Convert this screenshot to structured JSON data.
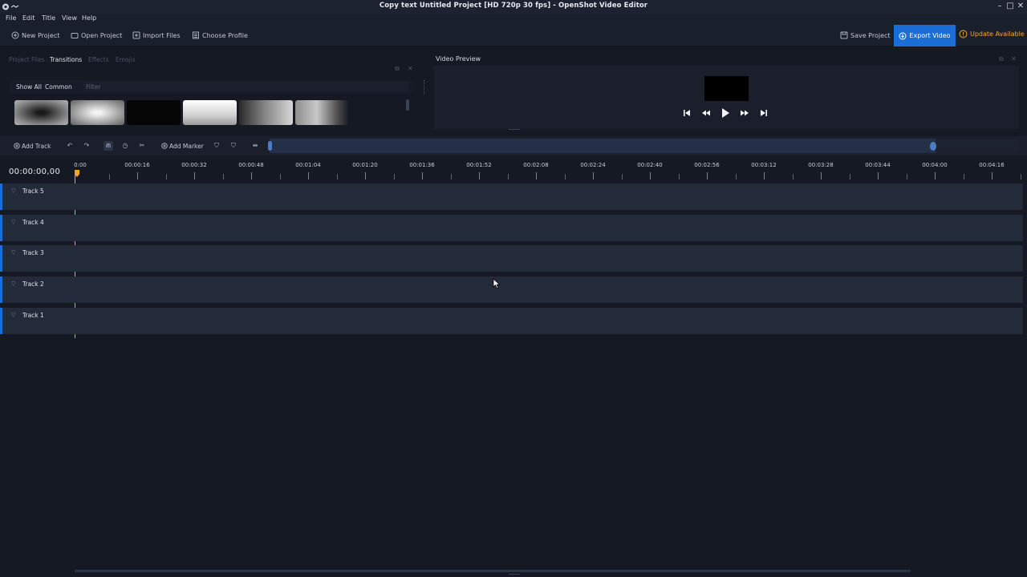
{
  "window": {
    "title": "Copy text  Untitled Project [HD 720p 30 fps] - OpenShot Video Editor",
    "minimize": "–",
    "maximize": "□",
    "close": "✕"
  },
  "menu": [
    "File",
    "Edit",
    "Title",
    "View",
    "Help"
  ],
  "toolbar": {
    "new_project": "New Project",
    "open_project": "Open Project",
    "import_files": "Import Files",
    "choose_profile": "Choose Profile",
    "save_project": "Save Project",
    "export_video": "Export Video",
    "update_available": "Update Available"
  },
  "dock": {
    "tabs": [
      "Project Files",
      "Transitions",
      "Effects",
      "Emojis"
    ],
    "active_tab": "Transitions",
    "filter_chips": [
      "Show All",
      "Common"
    ],
    "filter_placeholder": "Filter"
  },
  "preview": {
    "label": "Video Preview"
  },
  "timeline_toolbar": {
    "add_track": "Add Track",
    "add_marker": "Add Marker"
  },
  "timeline": {
    "timecode": "00:00:00,00",
    "ruler_labels": [
      "0:00",
      "00:00:16",
      "00:00:32",
      "00:00:48",
      "00:01:04",
      "00:01:20",
      "00:01:36",
      "00:01:52",
      "00:02:08",
      "00:02:24",
      "00:02:40",
      "00:02:56",
      "00:03:12",
      "00:03:28",
      "00:03:44",
      "00:04:00",
      "00:04:16"
    ],
    "tracks": [
      "Track 5",
      "Track 4",
      "Track 3",
      "Track 2",
      "Track 1"
    ]
  },
  "colors": {
    "accent": "#1b6ed6",
    "update": "#f2a93b",
    "playhead": "#f5a623"
  }
}
